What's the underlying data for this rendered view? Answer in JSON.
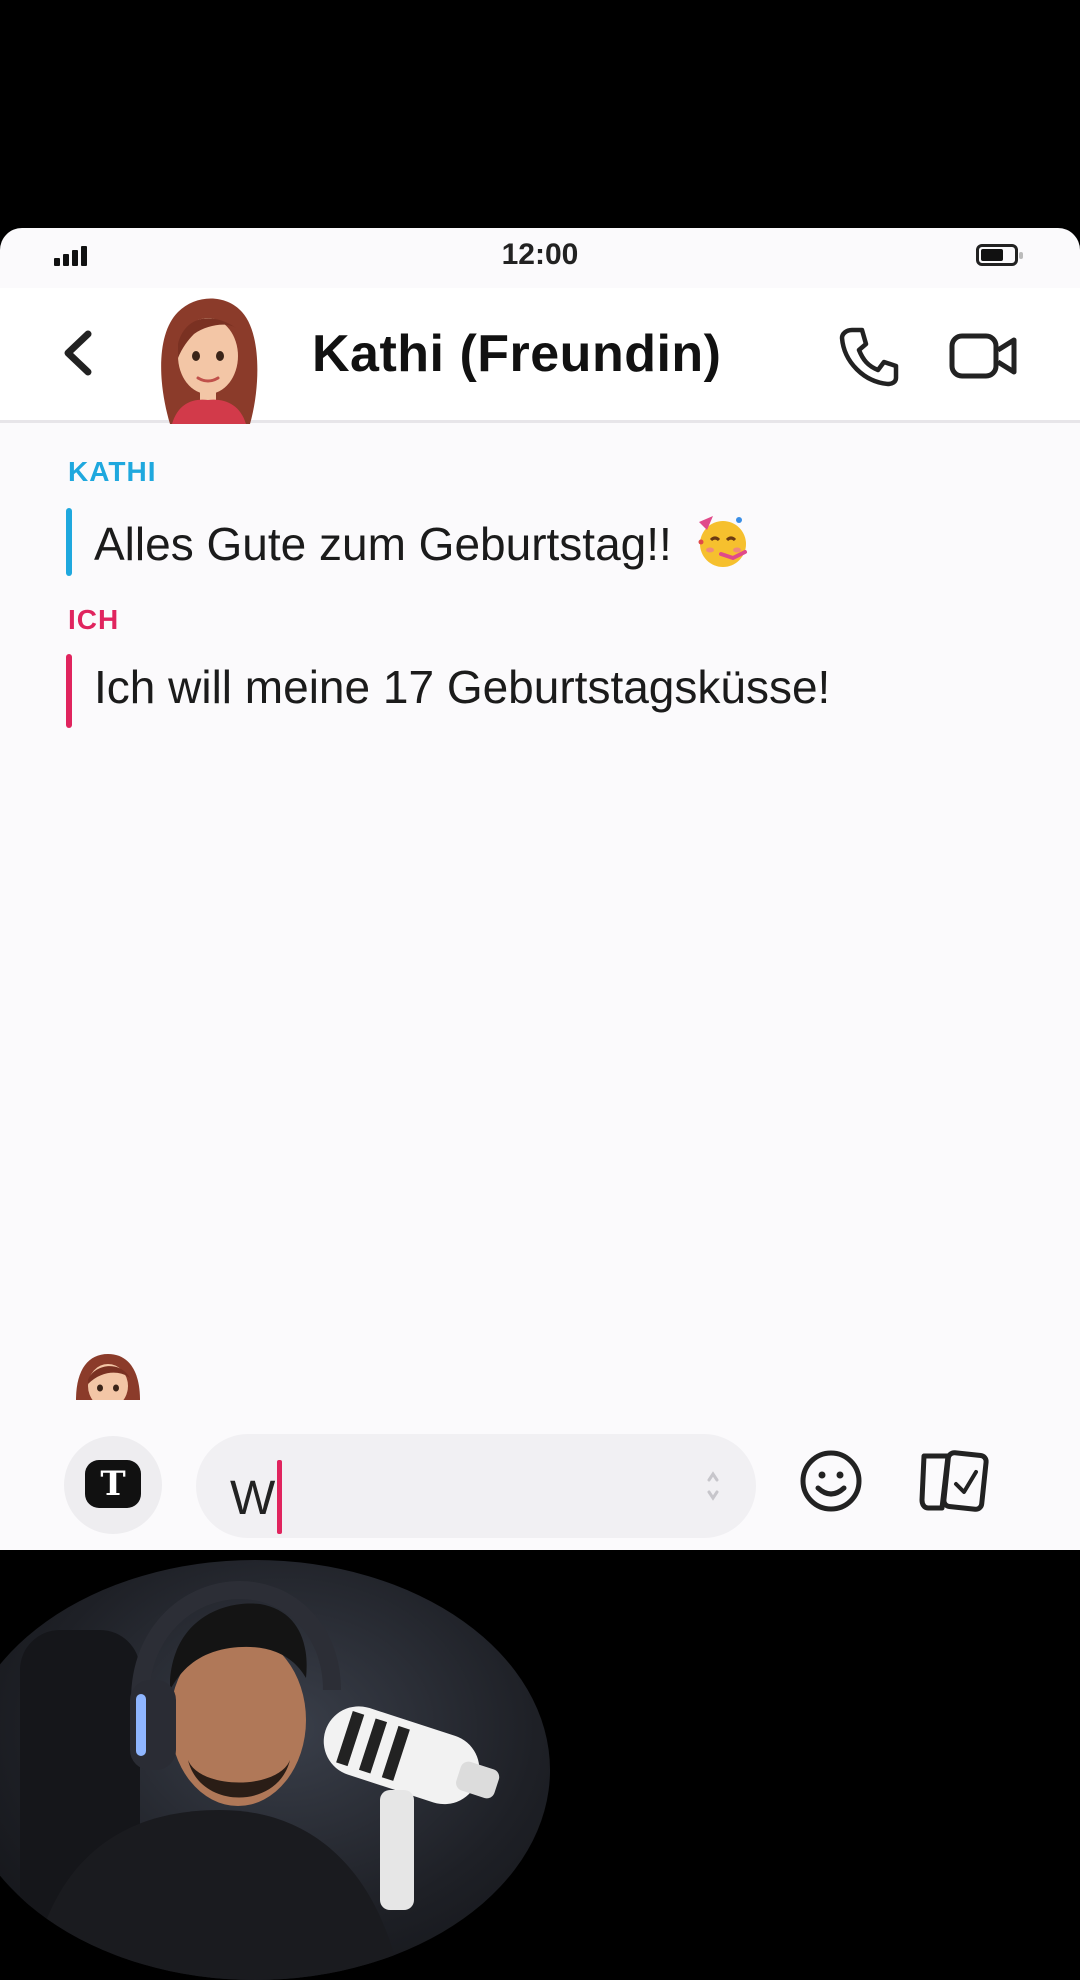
{
  "status_bar": {
    "time": "12:00"
  },
  "header": {
    "contact_name": "Kathi (Freundin)"
  },
  "messages": [
    {
      "author": "KATHI",
      "text": "Alles Gute zum Geburtstag!!",
      "color": "#1fa8de",
      "emoji": "partying-face"
    },
    {
      "author": "ICH",
      "text": "Ich will meine 17 Geburtstagsküsse!",
      "color": "#e0245e"
    }
  ],
  "composer": {
    "value": "W"
  },
  "colors": {
    "kathi_accent": "#1fa8de",
    "me_accent": "#e0245e",
    "caret": "#e0245e"
  }
}
